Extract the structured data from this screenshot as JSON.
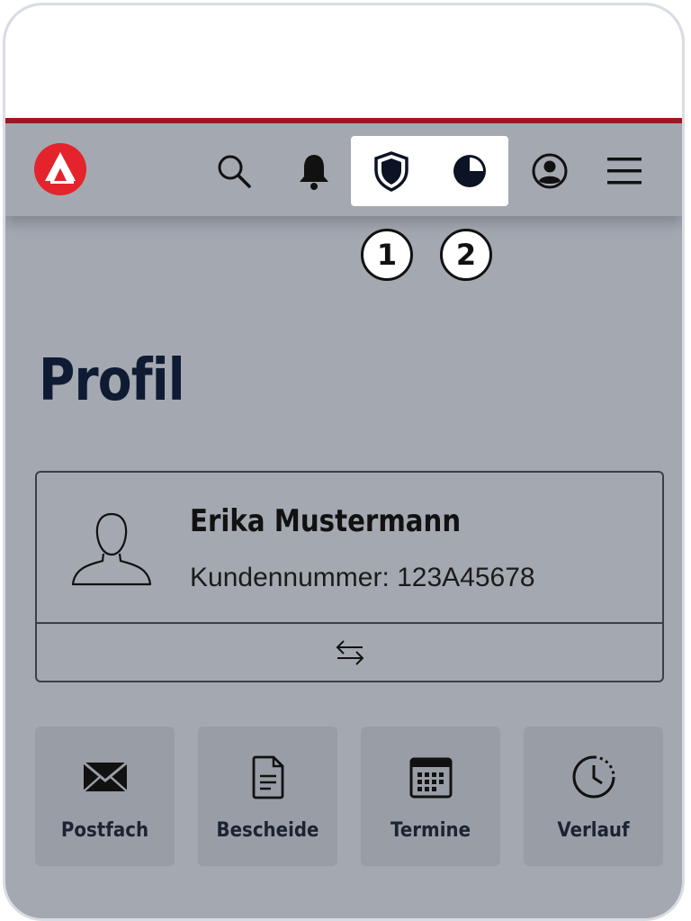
{
  "header": {
    "logo": "arbeitsagentur-logo",
    "icons": [
      "search-icon",
      "bell-icon",
      "shield-icon",
      "contrast-icon",
      "account-icon",
      "menu-icon"
    ],
    "badges": [
      "1",
      "2"
    ],
    "accent_color": "#a3161f"
  },
  "page": {
    "title": "Profil"
  },
  "profile": {
    "name": "Erika Mustermann",
    "customer_number": "Kundennummer: 123A45678",
    "switch_icon": "switch-arrows-icon"
  },
  "tiles": [
    {
      "label": "Postfach",
      "icon": "envelope-icon"
    },
    {
      "label": "Bescheide",
      "icon": "document-icon"
    },
    {
      "label": "Termine",
      "icon": "calendar-icon"
    },
    {
      "label": "Verlauf",
      "icon": "history-clock-icon"
    }
  ]
}
